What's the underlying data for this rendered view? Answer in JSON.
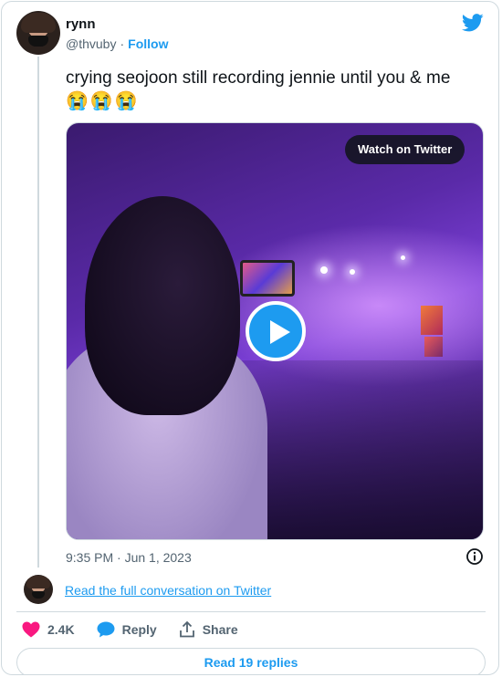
{
  "user": {
    "name": "rynn",
    "handle": "@thvuby",
    "separator": "·",
    "follow_label": "Follow"
  },
  "tweet": {
    "text": "crying seojoon still recording jennie until you & me",
    "emojis": "😭😭😭",
    "timestamp": "9:35 PM · Jun 1, 2023"
  },
  "media": {
    "watch_label": "Watch on Twitter"
  },
  "conversation_link": "Read the full conversation on Twitter",
  "actions": {
    "likes": "2.4K",
    "reply_label": "Reply",
    "share_label": "Share"
  },
  "read_replies_label": "Read 19 replies",
  "colors": {
    "accent": "#1d9bf0",
    "like": "#f91880",
    "muted": "#536471",
    "border": "#cfd9de"
  }
}
